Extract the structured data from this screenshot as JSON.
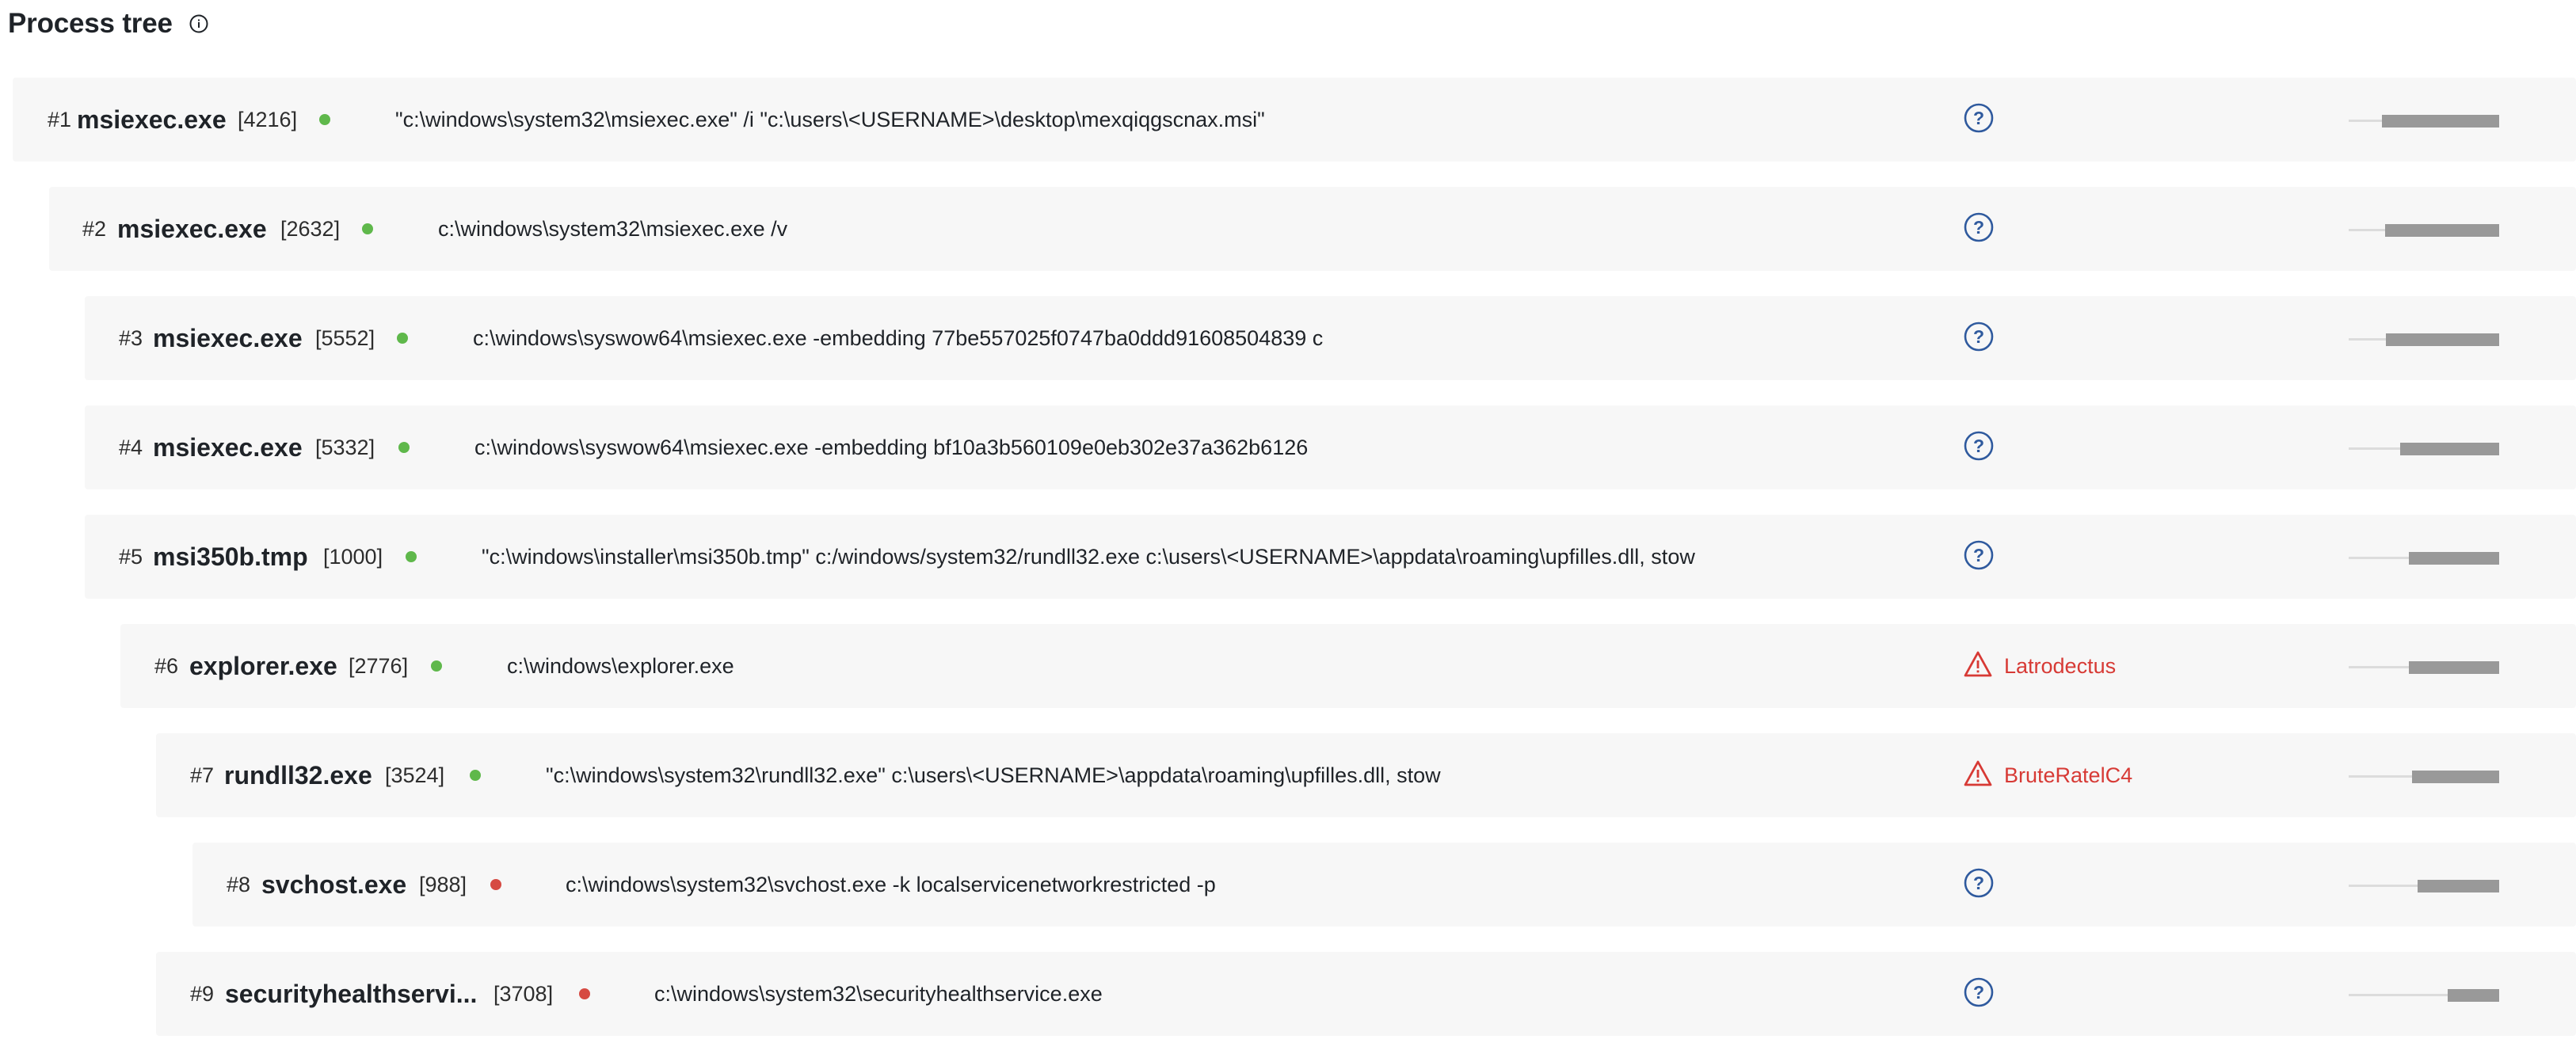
{
  "header": {
    "title": "Process tree",
    "info_icon": "info-circle-icon"
  },
  "colors": {
    "running": "#5fb84b",
    "terminated": "#d64a42",
    "malicious": "#d73a35",
    "unknown_icon": "#2f5a9e",
    "row_bg": "#f7f7f7"
  },
  "processes": [
    {
      "index": "#1",
      "name": "msiexec.exe",
      "pid": "[4216]",
      "status": "running",
      "command": "\"c:\\windows\\system32\\msiexec.exe\" /i \"c:\\users\\<USERNAME>\\desktop\\mexqiqgscnax.msi\"",
      "verdict": {
        "type": "unknown",
        "label": ""
      },
      "activity": 0.78
    },
    {
      "index": "#2",
      "name": "msiexec.exe",
      "pid": "[2632]",
      "status": "running",
      "command": "c:\\windows\\system32\\msiexec.exe /v",
      "verdict": {
        "type": "unknown",
        "label": ""
      },
      "activity": 0.76
    },
    {
      "index": "#3",
      "name": "msiexec.exe",
      "pid": "[5552]",
      "status": "running",
      "command": "c:\\windows\\syswow64\\msiexec.exe -embedding 77be557025f0747ba0ddd91608504839 c",
      "verdict": {
        "type": "unknown",
        "label": ""
      },
      "activity": 0.75
    },
    {
      "index": "#4",
      "name": "msiexec.exe",
      "pid": "[5332]",
      "status": "running",
      "command": "c:\\windows\\syswow64\\msiexec.exe -embedding bf10a3b560109e0eb302e37a362b6126",
      "verdict": {
        "type": "unknown",
        "label": ""
      },
      "activity": 0.66
    },
    {
      "index": "#5",
      "name": "msi350b.tmp",
      "pid": "[1000]",
      "status": "running",
      "command": "\"c:\\windows\\installer\\msi350b.tmp\" c:/windows/system32/rundll32.exe c:\\users\\<USERNAME>\\appdata\\roaming\\upfilles.dll, stow",
      "verdict": {
        "type": "unknown",
        "label": ""
      },
      "activity": 0.6
    },
    {
      "index": "#6",
      "name": "explorer.exe",
      "pid": "[2776]",
      "status": "running",
      "command": "c:\\windows\\explorer.exe",
      "verdict": {
        "type": "malicious",
        "label": "Latrodectus"
      },
      "activity": 0.6
    },
    {
      "index": "#7",
      "name": "rundll32.exe",
      "pid": "[3524]",
      "status": "running",
      "command": "\"c:\\windows\\system32\\rundll32.exe\" c:\\users\\<USERNAME>\\appdata\\roaming\\upfilles.dll, stow",
      "verdict": {
        "type": "malicious",
        "label": "BruteRatelC4"
      },
      "activity": 0.58
    },
    {
      "index": "#8",
      "name": "svchost.exe",
      "pid": "[988]",
      "status": "terminated",
      "command": "c:\\windows\\system32\\svchost.exe -k localservicenetworkrestricted -p",
      "verdict": {
        "type": "unknown",
        "label": ""
      },
      "activity": 0.54
    },
    {
      "index": "#9",
      "name": "securityhealthservi...",
      "pid": "[3708]",
      "status": "terminated",
      "command": "c:\\windows\\system32\\securityhealthservice.exe",
      "verdict": {
        "type": "unknown",
        "label": ""
      },
      "activity": 0.34
    }
  ]
}
